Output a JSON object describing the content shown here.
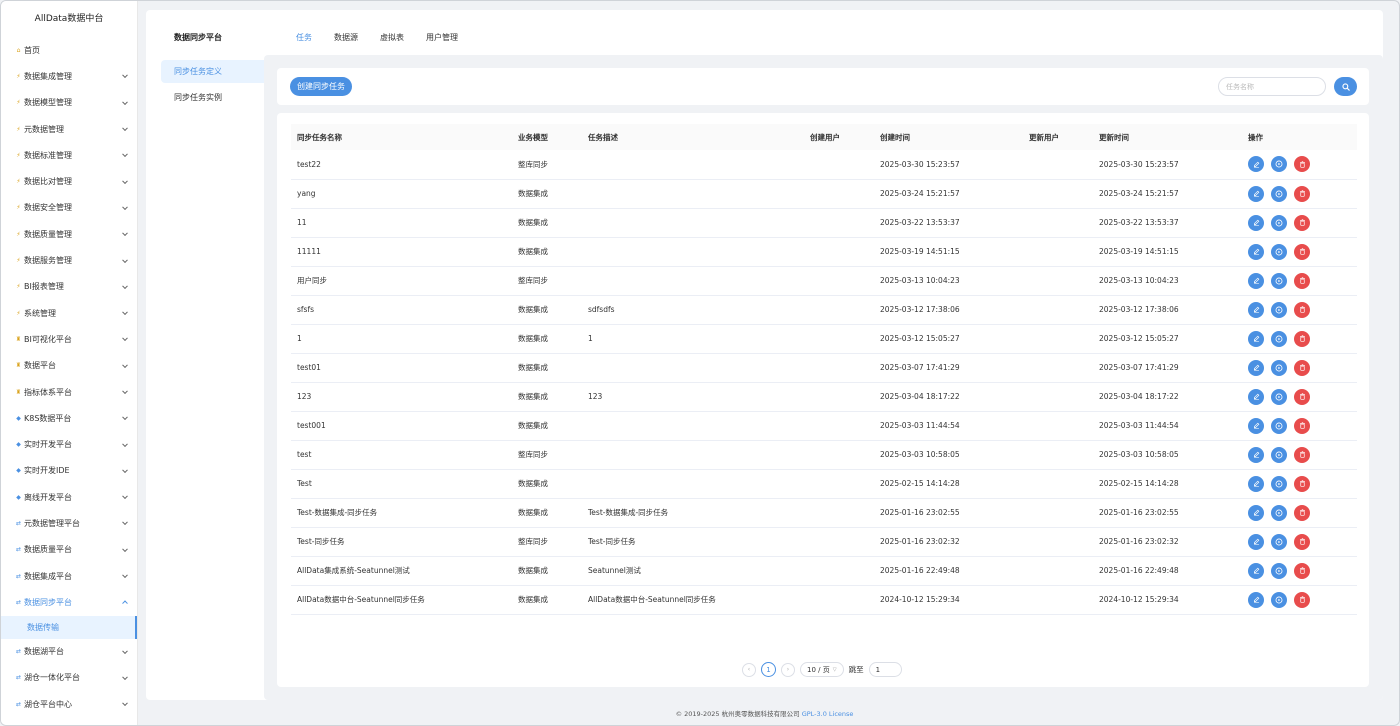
{
  "brand": "AllData数据中台",
  "sidebar": {
    "items": [
      {
        "label": "首页",
        "icon": "home-icon",
        "expandable": false
      },
      {
        "label": "数据集成管理",
        "icon": "bolt-icon",
        "expandable": true
      },
      {
        "label": "数据模型管理",
        "icon": "bolt-icon",
        "expandable": true
      },
      {
        "label": "元数据管理",
        "icon": "bolt-icon",
        "expandable": true
      },
      {
        "label": "数据标准管理",
        "icon": "bolt-icon",
        "expandable": true
      },
      {
        "label": "数据比对管理",
        "icon": "bolt-icon",
        "expandable": true
      },
      {
        "label": "数据安全管理",
        "icon": "bolt-icon",
        "expandable": true
      },
      {
        "label": "数据质量管理",
        "icon": "bolt-icon",
        "expandable": true
      },
      {
        "label": "数据服务管理",
        "icon": "bolt-icon",
        "expandable": true
      },
      {
        "label": "BI报表管理",
        "icon": "bolt-icon",
        "expandable": true
      },
      {
        "label": "系统管理",
        "icon": "bolt-icon",
        "expandable": true
      },
      {
        "label": "BI可视化平台",
        "icon": "trophy-icon",
        "expandable": true
      },
      {
        "label": "数据平台",
        "icon": "trophy-icon",
        "expandable": true
      },
      {
        "label": "指标体系平台",
        "icon": "trophy-icon",
        "expandable": true
      },
      {
        "label": "K8S数据平台",
        "icon": "diamond-icon",
        "expandable": true
      },
      {
        "label": "实时开发平台",
        "icon": "diamond-icon",
        "expandable": true
      },
      {
        "label": "实时开发IDE",
        "icon": "diamond-icon",
        "expandable": true
      },
      {
        "label": "离线开发平台",
        "icon": "diamond-icon",
        "expandable": true
      },
      {
        "label": "元数据管理平台",
        "icon": "sync-icon",
        "expandable": true
      },
      {
        "label": "数据质量平台",
        "icon": "sync-icon",
        "expandable": true
      },
      {
        "label": "数据集成平台",
        "icon": "sync-icon",
        "expandable": true
      },
      {
        "label": "数据同步平台",
        "icon": "sync-icon",
        "expandable": true,
        "open": true
      },
      {
        "label": "数据湖平台",
        "icon": "sync-icon",
        "expandable": true
      },
      {
        "label": "湖仓一体化平台",
        "icon": "sync-icon",
        "expandable": true
      },
      {
        "label": "湖仓平台中心",
        "icon": "sync-icon",
        "expandable": true
      }
    ],
    "sub_item": "数据传输"
  },
  "header": {
    "platform_title": "数据同步平台",
    "tabs": [
      "任务",
      "数据源",
      "虚拟表",
      "用户管理"
    ]
  },
  "left_nav": [
    "同步任务定义",
    "同步任务实例"
  ],
  "toolbar": {
    "create_label": "创建同步任务",
    "search_placeholder": "任务名称"
  },
  "table": {
    "columns": [
      "同步任务名称",
      "业务模型",
      "任务描述",
      "创建用户",
      "创建时间",
      "更新用户",
      "更新时间",
      "操作"
    ],
    "rows": [
      [
        "test22",
        "整库同步",
        "",
        "",
        "2025-03-30 15:23:57",
        "",
        "2025-03-30 15:23:57"
      ],
      [
        "yang",
        "数据集成",
        "",
        "",
        "2025-03-24 15:21:57",
        "",
        "2025-03-24 15:21:57"
      ],
      [
        "11",
        "数据集成",
        "",
        "",
        "2025-03-22 13:53:37",
        "",
        "2025-03-22 13:53:37"
      ],
      [
        "11111",
        "数据集成",
        "",
        "",
        "2025-03-19 14:51:15",
        "",
        "2025-03-19 14:51:15"
      ],
      [
        "用户同步",
        "整库同步",
        "",
        "",
        "2025-03-13 10:04:23",
        "",
        "2025-03-13 10:04:23"
      ],
      [
        "sfsfs",
        "数据集成",
        "sdfsdfs",
        "",
        "2025-03-12 17:38:06",
        "",
        "2025-03-12 17:38:06"
      ],
      [
        "1",
        "数据集成",
        "1",
        "",
        "2025-03-12 15:05:27",
        "",
        "2025-03-12 15:05:27"
      ],
      [
        "test01",
        "数据集成",
        "",
        "",
        "2025-03-07 17:41:29",
        "",
        "2025-03-07 17:41:29"
      ],
      [
        "123",
        "数据集成",
        "123",
        "",
        "2025-03-04 18:17:22",
        "",
        "2025-03-04 18:17:22"
      ],
      [
        "test001",
        "数据集成",
        "",
        "",
        "2025-03-03 11:44:54",
        "",
        "2025-03-03 11:44:54"
      ],
      [
        "test",
        "整库同步",
        "",
        "",
        "2025-03-03 10:58:05",
        "",
        "2025-03-03 10:58:05"
      ],
      [
        "Test",
        "数据集成",
        "",
        "",
        "2025-02-15 14:14:28",
        "",
        "2025-02-15 14:14:28"
      ],
      [
        "Test-数据集成-同步任务",
        "数据集成",
        "Test-数据集成-同步任务",
        "",
        "2025-01-16 23:02:55",
        "",
        "2025-01-16 23:02:55"
      ],
      [
        "Test-同步任务",
        "整库同步",
        "Test-同步任务",
        "",
        "2025-01-16 23:02:32",
        "",
        "2025-01-16 23:02:32"
      ],
      [
        "AllData集成系统-Seatunnel测试",
        "数据集成",
        "Seatunnel测试",
        "",
        "2025-01-16 22:49:48",
        "",
        "2025-01-16 22:49:48"
      ],
      [
        "AllData数据中台-Seatunnel同步任务",
        "数据集成",
        "AllData数据中台-Seatunnel同步任务",
        "",
        "2024-10-12 15:29:34",
        "",
        "2024-10-12 15:29:34"
      ]
    ]
  },
  "pagination": {
    "current_page": "1",
    "page_size": "10 / 页",
    "jump_label": "跳至",
    "jump_value": "1"
  },
  "footer": {
    "copyright": "© 2019-2025 杭州奥零数据科技有限公司",
    "license": "GPL-3.0 License"
  },
  "colors": {
    "accent": "#4a90e2",
    "danger": "#e84c4c",
    "background": "#f0f2f5"
  }
}
